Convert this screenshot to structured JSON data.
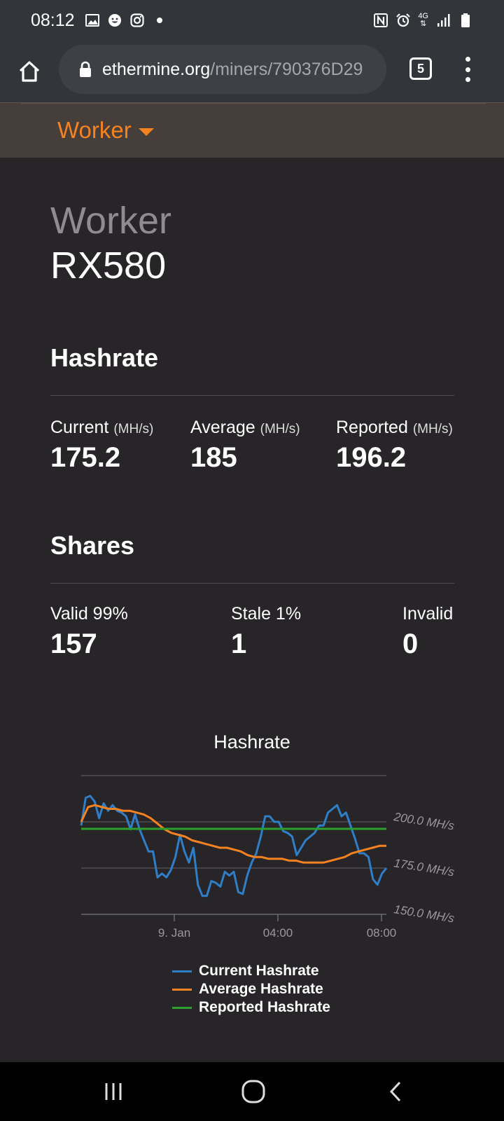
{
  "status_bar": {
    "time": "08:12",
    "network": "4G",
    "left_icons": [
      "gallery-icon",
      "smiley-icon",
      "instagram-icon",
      "dot-icon"
    ],
    "right_icons": [
      "nfc-icon",
      "alarm-icon",
      "signal-icon",
      "battery-icon"
    ]
  },
  "browser": {
    "url_domain": "ethermine.org",
    "url_path": "/miners/790376D29",
    "tab_count": "5"
  },
  "nav": {
    "worker_dropdown": "Worker"
  },
  "worker": {
    "label": "Worker",
    "name": "RX580"
  },
  "hashrate": {
    "title": "Hashrate",
    "current": {
      "label": "Current",
      "unit": "(MH/s)",
      "value": "175.2"
    },
    "average": {
      "label": "Average",
      "unit": "(MH/s)",
      "value": "185"
    },
    "reported": {
      "label": "Reported",
      "unit": "(MH/s)",
      "value": "196.2"
    }
  },
  "shares": {
    "title": "Shares",
    "valid": {
      "label": "Valid 99%",
      "value": "157"
    },
    "stale": {
      "label": "Stale 1%",
      "value": "1"
    },
    "invalid": {
      "label": "Invalid",
      "value": "0"
    }
  },
  "chart_data": {
    "type": "line",
    "title": "Hashrate",
    "x_ticks": [
      "9. Jan",
      "04:00",
      "08:00"
    ],
    "y_ticks": [
      "200.0 MH/s",
      "175.0 MH/s",
      "150.0 MH/s"
    ],
    "ylim": [
      150,
      225
    ],
    "grid": true,
    "legend_placement": "bottom",
    "series": [
      {
        "name": "Current Hashrate",
        "color": "#2f7ec8",
        "values": [
          198,
          213,
          214,
          211,
          202,
          210,
          206,
          209,
          206,
          205,
          203,
          196,
          204,
          196,
          190,
          184,
          184,
          170,
          172,
          170,
          174,
          181,
          193,
          184,
          178,
          186,
          166,
          160,
          160,
          168,
          167,
          165,
          173,
          171,
          173,
          162,
          161,
          171,
          178,
          183,
          192,
          203,
          203,
          200,
          200,
          195,
          194,
          192,
          182,
          186,
          190,
          192,
          194,
          198,
          198,
          205,
          207,
          209,
          203,
          205,
          198,
          191,
          183,
          183,
          181,
          169,
          166,
          172,
          175
        ]
      },
      {
        "name": "Average Hashrate",
        "color": "#f58220",
        "values": [
          200,
          208,
          209,
          208,
          207,
          207,
          206,
          206,
          205,
          204,
          202,
          199,
          196,
          194,
          193,
          192,
          190,
          189,
          188,
          187,
          186,
          186,
          185,
          184,
          182,
          181,
          181,
          180,
          180,
          180,
          179,
          179,
          178,
          178,
          178,
          178,
          179,
          180,
          181,
          183,
          184,
          185,
          186,
          187,
          187
        ]
      },
      {
        "name": "Reported Hashrate",
        "color": "#2ca02c",
        "values": [
          196.2,
          196.2
        ]
      }
    ]
  },
  "system_nav": {
    "icons": [
      "recents-icon",
      "home-circle-icon",
      "back-icon"
    ]
  }
}
